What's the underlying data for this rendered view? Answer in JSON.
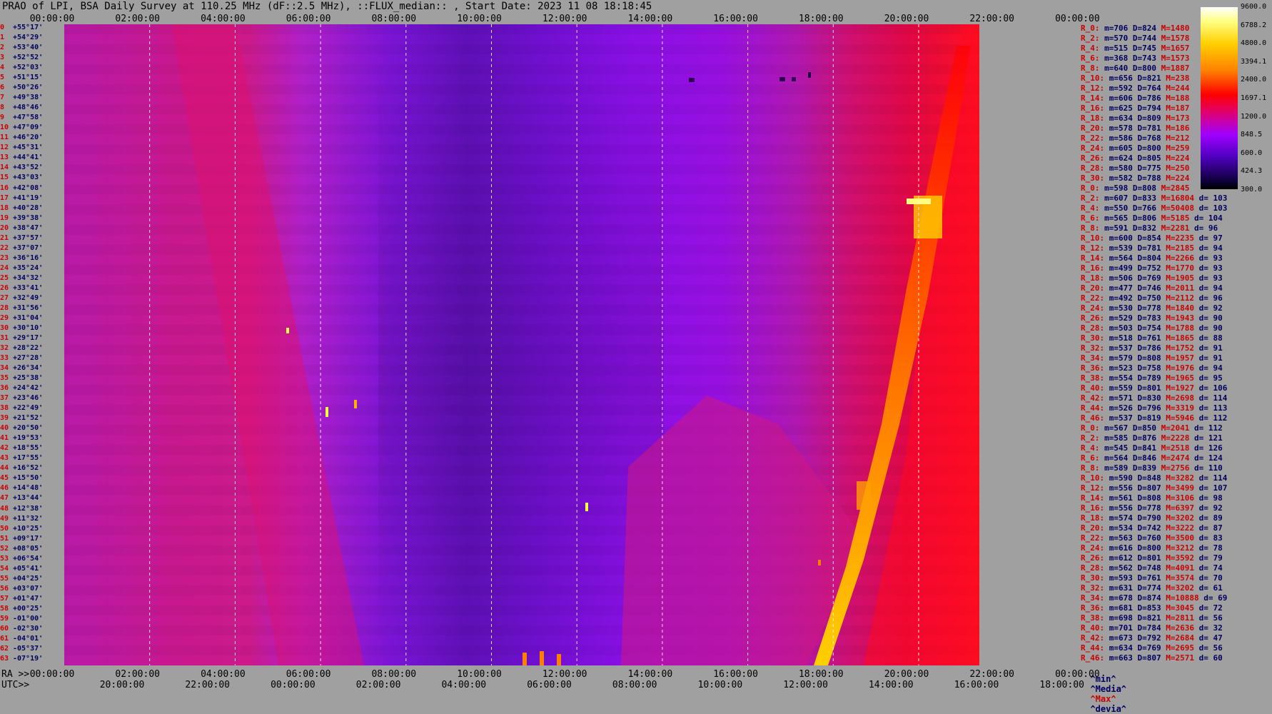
{
  "title": "PRAO of LPI, BSA Daily Survey at 110.25 MHz (dF::2.5 MHz), ::FLUX_median:: , Start Date: 2023 11 08 18:18:45",
  "top_ticks": [
    "00:00:00",
    "02:00:00",
    "04:00:00",
    "06:00:00",
    "08:00:00",
    "10:00:00",
    "12:00:00",
    "14:00:00",
    "16:00:00",
    "18:00:00",
    "20:00:00",
    "22:00:00",
    "00:00:00"
  ],
  "bottom_ra_label": "RA >>",
  "bottom_ra_ticks": [
    "00:00:00",
    "02:00:00",
    "04:00:00",
    "06:00:00",
    "08:00:00",
    "10:00:00",
    "12:00:00",
    "14:00:00",
    "16:00:00",
    "18:00:00",
    "20:00:00",
    "22:00:00",
    "00:00:00"
  ],
  "bottom_utc_label": "UTC>>",
  "bottom_utc_ticks": [
    "20:00:00",
    "22:00:00",
    "00:00:00",
    "02:00:00",
    "04:00:00",
    "06:00:00",
    "08:00:00",
    "10:00:00",
    "12:00:00",
    "14:00:00",
    "16:00:00",
    "18:00:00"
  ],
  "colorbar": {
    "labels": [
      "9600.0",
      "6788.2",
      "4800.0",
      "3394.1",
      "2400.0",
      "1697.1",
      "1200.0",
      "848.5",
      "600.0",
      "424.3",
      "300.0"
    ],
    "scale": "log",
    "min": 300.0,
    "max": 9600.0
  },
  "dec_rows": [
    [
      "0",
      "+55°17'"
    ],
    [
      "1",
      "+54°29'"
    ],
    [
      "2",
      "+53°40'"
    ],
    [
      "3",
      "+52°52'"
    ],
    [
      "4",
      "+52°03'"
    ],
    [
      "5",
      "+51°15'"
    ],
    [
      "6",
      "+50°26'"
    ],
    [
      "7",
      "+49°38'"
    ],
    [
      "8",
      "+48°46'"
    ],
    [
      "9",
      "+47°58'"
    ],
    [
      "10",
      "+47°09'"
    ],
    [
      "11",
      "+46°20'"
    ],
    [
      "12",
      "+45°31'"
    ],
    [
      "13",
      "+44°41'"
    ],
    [
      "14",
      "+43°52'"
    ],
    [
      "15",
      "+43°03'"
    ],
    [
      "16",
      "+42°08'"
    ],
    [
      "17",
      "+41°19'"
    ],
    [
      "18",
      "+40°28'"
    ],
    [
      "19",
      "+39°38'"
    ],
    [
      "20",
      "+38°47'"
    ],
    [
      "21",
      "+37°57'"
    ],
    [
      "22",
      "+37°07'"
    ],
    [
      "23",
      "+36°16'"
    ],
    [
      "24",
      "+35°24'"
    ],
    [
      "25",
      "+34°32'"
    ],
    [
      "26",
      "+33°41'"
    ],
    [
      "27",
      "+32°49'"
    ],
    [
      "28",
      "+31°56'"
    ],
    [
      "29",
      "+31°04'"
    ],
    [
      "30",
      "+30°10'"
    ],
    [
      "31",
      "+29°17'"
    ],
    [
      "32",
      "+28°22'"
    ],
    [
      "33",
      "+27°28'"
    ],
    [
      "34",
      "+26°34'"
    ],
    [
      "35",
      "+25°38'"
    ],
    [
      "36",
      "+24°42'"
    ],
    [
      "37",
      "+23°46'"
    ],
    [
      "38",
      "+22°49'"
    ],
    [
      "39",
      "+21°52'"
    ],
    [
      "40",
      "+20°50'"
    ],
    [
      "41",
      "+19°53'"
    ],
    [
      "42",
      "+18°55'"
    ],
    [
      "43",
      "+17°55'"
    ],
    [
      "44",
      "+16°52'"
    ],
    [
      "45",
      "+15°50'"
    ],
    [
      "46",
      "+14°48'"
    ],
    [
      "47",
      "+13°44'"
    ],
    [
      "48",
      "+12°38'"
    ],
    [
      "49",
      "+11°32'"
    ],
    [
      "50",
      "+10°25'"
    ],
    [
      "51",
      "+09°17'"
    ],
    [
      "52",
      "+08°05'"
    ],
    [
      "53",
      "+06°54'"
    ],
    [
      "54",
      "+05°41'"
    ],
    [
      "55",
      "+04°25'"
    ],
    [
      "56",
      "+03°07'"
    ],
    [
      "57",
      "+01°47'"
    ],
    [
      "58",
      "+00°25'"
    ],
    [
      "59",
      "-01°00'"
    ],
    [
      "60",
      "-02°30'"
    ],
    [
      "61",
      "-04°01'"
    ],
    [
      "62",
      "-05°37'"
    ],
    [
      "63",
      "-07°19'"
    ]
  ],
  "stats_rows": [
    [
      "R_0:",
      "m=706",
      "D=824",
      "M=1480",
      ""
    ],
    [
      "R_2:",
      "m=570",
      "D=744",
      "M=1578",
      ""
    ],
    [
      "R_4:",
      "m=515",
      "D=745",
      "M=1657",
      ""
    ],
    [
      "R_6:",
      "m=368",
      "D=743",
      "M=1573",
      ""
    ],
    [
      "R_8:",
      "m=640",
      "D=800",
      "M=1887",
      ""
    ],
    [
      "R_10:",
      "m=656",
      "D=821",
      "M=238",
      ""
    ],
    [
      "R_12:",
      "m=592",
      "D=764",
      "M=244",
      ""
    ],
    [
      "R_14:",
      "m=606",
      "D=786",
      "M=188",
      ""
    ],
    [
      "R_16:",
      "m=625",
      "D=794",
      "M=187",
      ""
    ],
    [
      "R_18:",
      "m=634",
      "D=809",
      "M=173",
      ""
    ],
    [
      "R_20:",
      "m=578",
      "D=781",
      "M=186",
      ""
    ],
    [
      "R_22:",
      "m=586",
      "D=768",
      "M=212",
      ""
    ],
    [
      "R_24:",
      "m=605",
      "D=800",
      "M=259",
      ""
    ],
    [
      "R_26:",
      "m=624",
      "D=805",
      "M=224",
      ""
    ],
    [
      "R_28:",
      "m=580",
      "D=775",
      "M=250",
      ""
    ],
    [
      "R_30:",
      "m=582",
      "D=788",
      "M=224",
      ""
    ],
    [
      "R_0:",
      "m=598",
      "D=808",
      "M=2845",
      ""
    ],
    [
      "R_2:",
      "m=607",
      "D=833",
      "M=16804",
      "d= 103"
    ],
    [
      "R_4:",
      "m=550",
      "D=766",
      "M=50408",
      "d= 103"
    ],
    [
      "R_6:",
      "m=565",
      "D=806",
      "M=5185",
      "d= 104"
    ],
    [
      "R_8:",
      "m=591",
      "D=832",
      "M=2281",
      "d= 96"
    ],
    [
      "R_10:",
      "m=600",
      "D=854",
      "M=2235",
      "d= 97"
    ],
    [
      "R_12:",
      "m=539",
      "D=781",
      "M=2185",
      "d= 94"
    ],
    [
      "R_14:",
      "m=564",
      "D=804",
      "M=2266",
      "d= 93"
    ],
    [
      "R_16:",
      "m=499",
      "D=752",
      "M=1770",
      "d= 93"
    ],
    [
      "R_18:",
      "m=506",
      "D=769",
      "M=1905",
      "d= 93"
    ],
    [
      "R_20:",
      "m=477",
      "D=746",
      "M=2011",
      "d= 94"
    ],
    [
      "R_22:",
      "m=492",
      "D=750",
      "M=2112",
      "d= 96"
    ],
    [
      "R_24:",
      "m=530",
      "D=778",
      "M=1840",
      "d= 92"
    ],
    [
      "R_26:",
      "m=529",
      "D=783",
      "M=1943",
      "d= 90"
    ],
    [
      "R_28:",
      "m=503",
      "D=754",
      "M=1788",
      "d= 90"
    ],
    [
      "R_30:",
      "m=518",
      "D=761",
      "M=1865",
      "d= 88"
    ],
    [
      "R_32:",
      "m=537",
      "D=786",
      "M=1752",
      "d= 91"
    ],
    [
      "R_34:",
      "m=579",
      "D=808",
      "M=1957",
      "d= 91"
    ],
    [
      "R_36:",
      "m=523",
      "D=758",
      "M=1976",
      "d= 94"
    ],
    [
      "R_38:",
      "m=554",
      "D=789",
      "M=1965",
      "d= 95"
    ],
    [
      "R_40:",
      "m=559",
      "D=801",
      "M=1927",
      "d= 106"
    ],
    [
      "R_42:",
      "m=571",
      "D=830",
      "M=2698",
      "d= 114"
    ],
    [
      "R_44:",
      "m=526",
      "D=796",
      "M=3319",
      "d= 113"
    ],
    [
      "R_46:",
      "m=537",
      "D=819",
      "M=5946",
      "d= 112"
    ],
    [
      "R_0:",
      "m=567",
      "D=850",
      "M=2041",
      "d= 112"
    ],
    [
      "R_2:",
      "m=585",
      "D=876",
      "M=2228",
      "d= 121"
    ],
    [
      "R_4:",
      "m=545",
      "D=841",
      "M=2518",
      "d= 126"
    ],
    [
      "R_6:",
      "m=564",
      "D=846",
      "M=2474",
      "d= 124"
    ],
    [
      "R_8:",
      "m=589",
      "D=839",
      "M=2756",
      "d= 110"
    ],
    [
      "R_10:",
      "m=590",
      "D=848",
      "M=3282",
      "d= 114"
    ],
    [
      "R_12:",
      "m=556",
      "D=807",
      "M=3499",
      "d= 107"
    ],
    [
      "R_14:",
      "m=561",
      "D=808",
      "M=3106",
      "d= 98"
    ],
    [
      "R_16:",
      "m=556",
      "D=778",
      "M=6397",
      "d= 92"
    ],
    [
      "R_18:",
      "m=574",
      "D=790",
      "M=3202",
      "d= 89"
    ],
    [
      "R_20:",
      "m=534",
      "D=742",
      "M=3222",
      "d= 87"
    ],
    [
      "R_22:",
      "m=563",
      "D=760",
      "M=3500",
      "d= 83"
    ],
    [
      "R_24:",
      "m=616",
      "D=800",
      "M=3212",
      "d= 78"
    ],
    [
      "R_26:",
      "m=612",
      "D=801",
      "M=3592",
      "d= 79"
    ],
    [
      "R_28:",
      "m=562",
      "D=748",
      "M=4091",
      "d= 74"
    ],
    [
      "R_30:",
      "m=593",
      "D=761",
      "M=3574",
      "d= 70"
    ],
    [
      "R_32:",
      "m=631",
      "D=774",
      "M=3202",
      "d= 61"
    ],
    [
      "R_34:",
      "m=678",
      "D=874",
      "M=10888",
      "d= 69"
    ],
    [
      "R_36:",
      "m=681",
      "D=853",
      "M=3045",
      "d= 72"
    ],
    [
      "R_38:",
      "m=698",
      "D=821",
      "M=2811",
      "d= 56"
    ],
    [
      "R_40:",
      "m=701",
      "D=784",
      "M=2636",
      "d= 32"
    ],
    [
      "R_42:",
      "m=673",
      "D=792",
      "M=2684",
      "d= 47"
    ],
    [
      "R_44:",
      "m=634",
      "D=769",
      "M=2695",
      "d= 56"
    ],
    [
      "R_46:",
      "m=663",
      "D=807",
      "M=2571",
      "d= 60"
    ]
  ],
  "stats_footer": [
    "^min^",
    "^Media^",
    "^Max^",
    "^devia^"
  ],
  "chart_data": {
    "type": "heatmap",
    "title": "PRAO of LPI, BSA Daily Survey at 110.25 MHz (dF::2.5 MHz), ::FLUX_median:: , Start Date: 2023 11 08 18:18:45",
    "x_axis": "RA 00:00:00 to 00:00:00 (24h)",
    "y_axis": "Declination +55°17' to -07°19'",
    "colorscale": [
      "#000000",
      "#100040",
      "#5000c0",
      "#a000ff",
      "#e00070",
      "#ff0000",
      "#ff8000",
      "#ffd000",
      "#ffff80",
      "#ffffff"
    ],
    "vmin": 300.0,
    "vmax": 9600.0,
    "grid": true
  }
}
